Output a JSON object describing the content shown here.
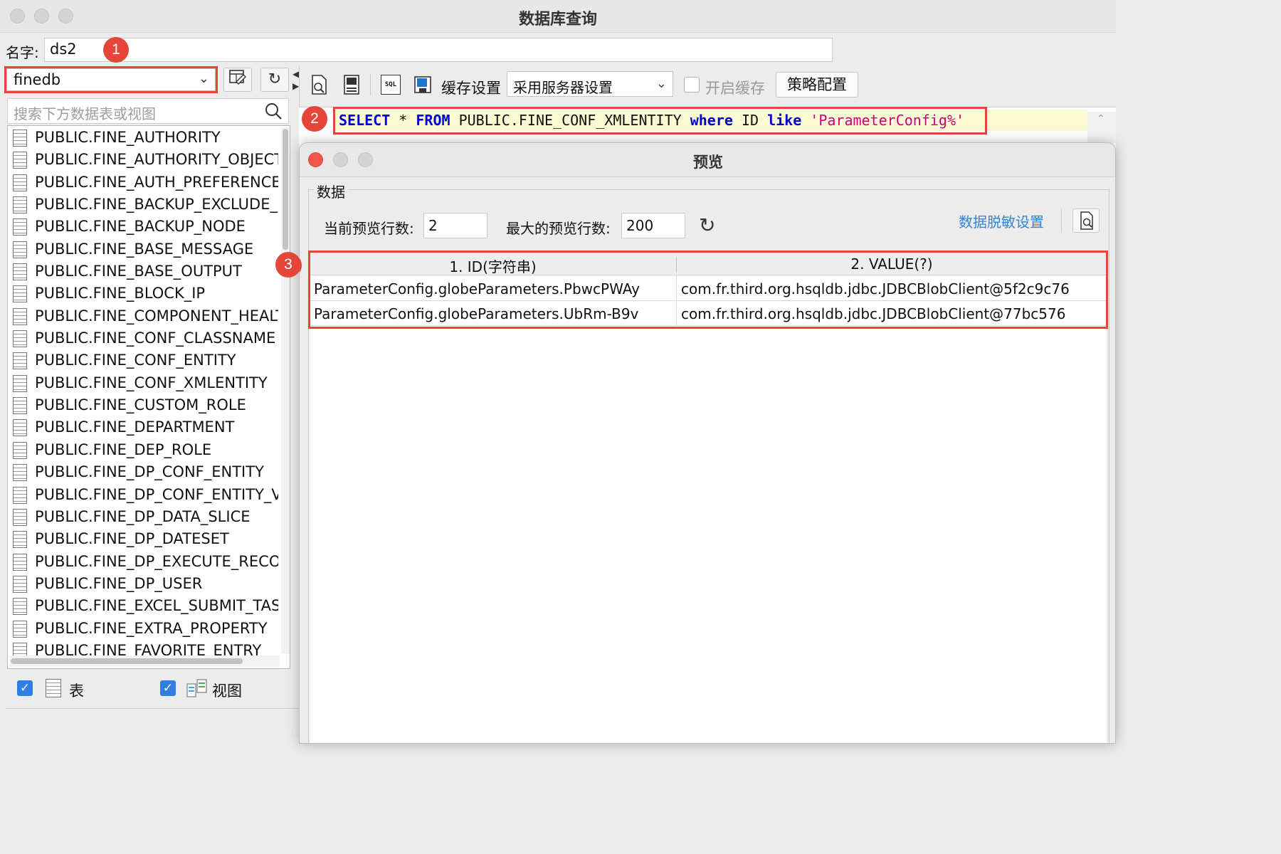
{
  "window": {
    "title": "数据库查询"
  },
  "name_row": {
    "label": "名字:",
    "value": "ds2"
  },
  "badges": {
    "b1": "1",
    "b2": "2",
    "b3": "3"
  },
  "datasource": {
    "selected": "finedb"
  },
  "search": {
    "placeholder": "搜索下方数据表或视图"
  },
  "tables": [
    "PUBLIC.FINE_AUTHORITY",
    "PUBLIC.FINE_AUTHORITY_OBJECT",
    "PUBLIC.FINE_AUTH_PREFERENCE",
    "PUBLIC.FINE_BACKUP_EXCLUDE_ENTITY",
    "PUBLIC.FINE_BACKUP_NODE",
    "PUBLIC.FINE_BASE_MESSAGE",
    "PUBLIC.FINE_BASE_OUTPUT",
    "PUBLIC.FINE_BLOCK_IP",
    "PUBLIC.FINE_COMPONENT_HEALTH",
    "PUBLIC.FINE_CONF_CLASSNAME",
    "PUBLIC.FINE_CONF_ENTITY",
    "PUBLIC.FINE_CONF_XMLENTITY",
    "PUBLIC.FINE_CUSTOM_ROLE",
    "PUBLIC.FINE_DEPARTMENT",
    "PUBLIC.FINE_DEP_ROLE",
    "PUBLIC.FINE_DP_CONF_ENTITY",
    "PUBLIC.FINE_DP_CONF_ENTITY_VALUE",
    "PUBLIC.FINE_DP_DATA_SLICE",
    "PUBLIC.FINE_DP_DATESET",
    "PUBLIC.FINE_DP_EXECUTE_RECORD",
    "PUBLIC.FINE_DP_USER",
    "PUBLIC.FINE_EXCEL_SUBMIT_TASK",
    "PUBLIC.FINE_EXTRA_PROPERTY",
    "PUBLIC.FINE_FAVORITE_ENTRY"
  ],
  "filters": {
    "table_label": "表",
    "view_label": "视图"
  },
  "toolbar": {
    "cache_label": "缓存设置",
    "cache_select": "采用服务器设置",
    "enable_cache": "开启缓存",
    "policy_button": "策略配置",
    "sql_icon_text": "SQL"
  },
  "sql": {
    "kw_select": "SELECT",
    "star": " * ",
    "kw_from": "FROM",
    "table_ref": " PUBLIC.FINE_CONF_XMLENTITY ",
    "kw_where": "where",
    "col": " ID ",
    "kw_like": "like",
    "literal": " 'ParameterConfig%'"
  },
  "preview": {
    "title": "预览",
    "group_label": "数据",
    "current_rows_label": "当前预览行数:",
    "current_rows_value": "2",
    "max_rows_label": "最大的预览行数:",
    "max_rows_value": "200",
    "mask_link": "数据脱敏设置",
    "columns": [
      "1. ID(字符串)",
      "2. VALUE(?)"
    ],
    "rows": [
      [
        "ParameterConfig.globeParameters.PbwcPWAy",
        "com.fr.third.org.hsqldb.jdbc.JDBCBlobClient@5f2c9c76"
      ],
      [
        "ParameterConfig.globeParameters.UbRm-B9v",
        "com.fr.third.org.hsqldb.jdbc.JDBCBlobClient@77bc576"
      ]
    ]
  },
  "colors": {
    "highlight": "#e6453a",
    "link": "#2f86d8",
    "checkbox": "#2f7fe0",
    "keyword": "#0000d0",
    "string": "#cc0077"
  }
}
